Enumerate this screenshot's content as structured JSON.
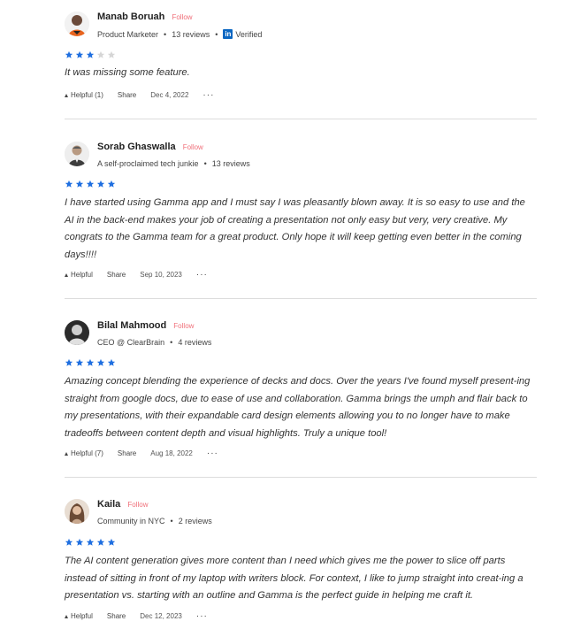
{
  "reviews": [
    {
      "name": "Manab Boruah",
      "follow": "Follow",
      "meta": [
        "Product Marketer",
        "13 reviews"
      ],
      "verified": "Verified",
      "rating": 3,
      "body": "It was missing some feature.",
      "helpful": "Helpful (1)",
      "share": "Share",
      "date": "Dec 4, 2022"
    },
    {
      "name": "Sorab Ghaswalla",
      "follow": "Follow",
      "meta": [
        "A self-proclaimed tech junkie",
        "13 reviews"
      ],
      "rating": 5,
      "body": "I have started using Gamma app and I must say I was pleasantly blown away. It is so easy to use and the AI in the back-end makes your job of creating a presentation not only easy but very, very creative. My congrats to the Gamma team for a great product. Only hope it will keep getting even better in the coming days!!!!",
      "helpful": "Helpful",
      "share": "Share",
      "date": "Sep 10, 2023"
    },
    {
      "name": "Bilal Mahmood",
      "follow": "Follow",
      "meta": [
        "CEO @ ClearBrain",
        "4 reviews"
      ],
      "rating": 5,
      "body": "Amazing concept blending the experience of decks and docs. Over the years I've found myself present-ing straight from google docs, due to ease of use and collaboration. Gamma brings the umph and flair back to my presentations, with their expandable card design elements allowing you to no longer have to make tradeoffs between content depth and visual highlights. Truly a unique tool!",
      "helpful": "Helpful (7)",
      "share": "Share",
      "date": "Aug 18, 2022"
    },
    {
      "name": "Kaila",
      "follow": "Follow",
      "meta": [
        "Community in NYC",
        "2 reviews"
      ],
      "rating": 5,
      "body": "The AI content generation gives more content than I need which gives me the power to slice off parts instead of sitting in front of my laptop with writers block. For context, I like to jump straight into creat-ing a presentation vs. starting with an outline and Gamma is the perfect guide in helping me craft it.",
      "helpful": "Helpful",
      "share": "Share",
      "date": "Dec 12, 2023"
    }
  ],
  "more_label": "···",
  "linkedin_label": "in",
  "colors": {
    "star": "#1f6fe0",
    "star_empty": "#d6d6d6",
    "follow": "#f0707a",
    "linkedin": "#0a66c2"
  }
}
